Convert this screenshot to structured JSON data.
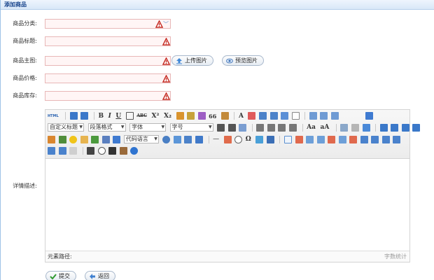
{
  "header": {
    "title": "添加商品"
  },
  "form": {
    "category_label": "商品分类:",
    "title_label": "商品标题:",
    "image_label": "商品主图:",
    "price_label": "商品价格:",
    "stock_label": "商品库存:",
    "desc_label": "详情描述:"
  },
  "buttons": {
    "upload_image": "上传图片",
    "preview_image": "预览图片",
    "submit": "提交",
    "back": "返回"
  },
  "editor": {
    "html_label": "HTML",
    "custom_title": "自定义标题",
    "paragraph_format": "段落格式",
    "font_family": "字体",
    "font_size": "字号",
    "code_language": "代码语言",
    "quote_mark": "66",
    "status_path": "元素路径:",
    "word_count": "字数统计"
  }
}
